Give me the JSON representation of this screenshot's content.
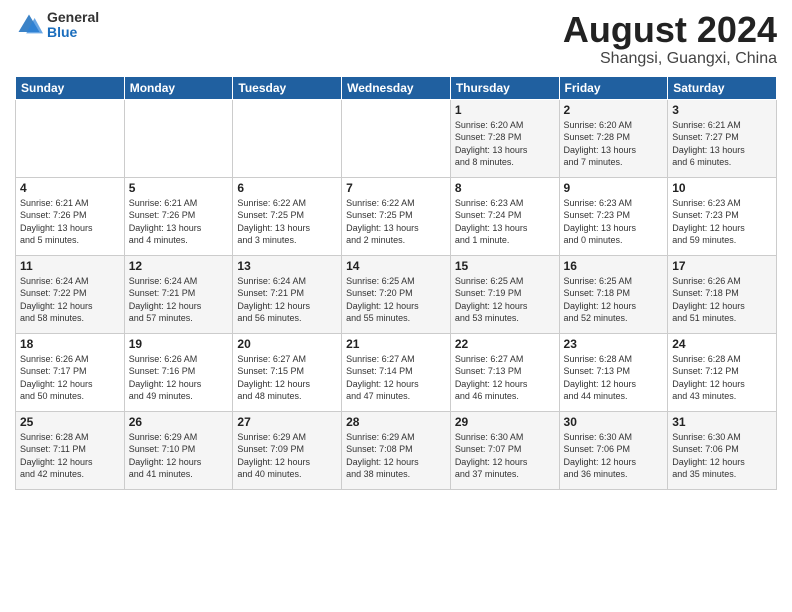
{
  "header": {
    "logo": {
      "general": "General",
      "blue": "Blue"
    },
    "title": "August 2024",
    "location": "Shangsi, Guangxi, China"
  },
  "weekdays": [
    "Sunday",
    "Monday",
    "Tuesday",
    "Wednesday",
    "Thursday",
    "Friday",
    "Saturday"
  ],
  "weeks": [
    [
      {
        "day": "",
        "info": ""
      },
      {
        "day": "",
        "info": ""
      },
      {
        "day": "",
        "info": ""
      },
      {
        "day": "",
        "info": ""
      },
      {
        "day": "1",
        "info": "Sunrise: 6:20 AM\nSunset: 7:28 PM\nDaylight: 13 hours\nand 8 minutes."
      },
      {
        "day": "2",
        "info": "Sunrise: 6:20 AM\nSunset: 7:28 PM\nDaylight: 13 hours\nand 7 minutes."
      },
      {
        "day": "3",
        "info": "Sunrise: 6:21 AM\nSunset: 7:27 PM\nDaylight: 13 hours\nand 6 minutes."
      }
    ],
    [
      {
        "day": "4",
        "info": "Sunrise: 6:21 AM\nSunset: 7:26 PM\nDaylight: 13 hours\nand 5 minutes."
      },
      {
        "day": "5",
        "info": "Sunrise: 6:21 AM\nSunset: 7:26 PM\nDaylight: 13 hours\nand 4 minutes."
      },
      {
        "day": "6",
        "info": "Sunrise: 6:22 AM\nSunset: 7:25 PM\nDaylight: 13 hours\nand 3 minutes."
      },
      {
        "day": "7",
        "info": "Sunrise: 6:22 AM\nSunset: 7:25 PM\nDaylight: 13 hours\nand 2 minutes."
      },
      {
        "day": "8",
        "info": "Sunrise: 6:23 AM\nSunset: 7:24 PM\nDaylight: 13 hours\nand 1 minute."
      },
      {
        "day": "9",
        "info": "Sunrise: 6:23 AM\nSunset: 7:23 PM\nDaylight: 13 hours\nand 0 minutes."
      },
      {
        "day": "10",
        "info": "Sunrise: 6:23 AM\nSunset: 7:23 PM\nDaylight: 12 hours\nand 59 minutes."
      }
    ],
    [
      {
        "day": "11",
        "info": "Sunrise: 6:24 AM\nSunset: 7:22 PM\nDaylight: 12 hours\nand 58 minutes."
      },
      {
        "day": "12",
        "info": "Sunrise: 6:24 AM\nSunset: 7:21 PM\nDaylight: 12 hours\nand 57 minutes."
      },
      {
        "day": "13",
        "info": "Sunrise: 6:24 AM\nSunset: 7:21 PM\nDaylight: 12 hours\nand 56 minutes."
      },
      {
        "day": "14",
        "info": "Sunrise: 6:25 AM\nSunset: 7:20 PM\nDaylight: 12 hours\nand 55 minutes."
      },
      {
        "day": "15",
        "info": "Sunrise: 6:25 AM\nSunset: 7:19 PM\nDaylight: 12 hours\nand 53 minutes."
      },
      {
        "day": "16",
        "info": "Sunrise: 6:25 AM\nSunset: 7:18 PM\nDaylight: 12 hours\nand 52 minutes."
      },
      {
        "day": "17",
        "info": "Sunrise: 6:26 AM\nSunset: 7:18 PM\nDaylight: 12 hours\nand 51 minutes."
      }
    ],
    [
      {
        "day": "18",
        "info": "Sunrise: 6:26 AM\nSunset: 7:17 PM\nDaylight: 12 hours\nand 50 minutes."
      },
      {
        "day": "19",
        "info": "Sunrise: 6:26 AM\nSunset: 7:16 PM\nDaylight: 12 hours\nand 49 minutes."
      },
      {
        "day": "20",
        "info": "Sunrise: 6:27 AM\nSunset: 7:15 PM\nDaylight: 12 hours\nand 48 minutes."
      },
      {
        "day": "21",
        "info": "Sunrise: 6:27 AM\nSunset: 7:14 PM\nDaylight: 12 hours\nand 47 minutes."
      },
      {
        "day": "22",
        "info": "Sunrise: 6:27 AM\nSunset: 7:13 PM\nDaylight: 12 hours\nand 46 minutes."
      },
      {
        "day": "23",
        "info": "Sunrise: 6:28 AM\nSunset: 7:13 PM\nDaylight: 12 hours\nand 44 minutes."
      },
      {
        "day": "24",
        "info": "Sunrise: 6:28 AM\nSunset: 7:12 PM\nDaylight: 12 hours\nand 43 minutes."
      }
    ],
    [
      {
        "day": "25",
        "info": "Sunrise: 6:28 AM\nSunset: 7:11 PM\nDaylight: 12 hours\nand 42 minutes."
      },
      {
        "day": "26",
        "info": "Sunrise: 6:29 AM\nSunset: 7:10 PM\nDaylight: 12 hours\nand 41 minutes."
      },
      {
        "day": "27",
        "info": "Sunrise: 6:29 AM\nSunset: 7:09 PM\nDaylight: 12 hours\nand 40 minutes."
      },
      {
        "day": "28",
        "info": "Sunrise: 6:29 AM\nSunset: 7:08 PM\nDaylight: 12 hours\nand 38 minutes."
      },
      {
        "day": "29",
        "info": "Sunrise: 6:30 AM\nSunset: 7:07 PM\nDaylight: 12 hours\nand 37 minutes."
      },
      {
        "day": "30",
        "info": "Sunrise: 6:30 AM\nSunset: 7:06 PM\nDaylight: 12 hours\nand 36 minutes."
      },
      {
        "day": "31",
        "info": "Sunrise: 6:30 AM\nSunset: 7:06 PM\nDaylight: 12 hours\nand 35 minutes."
      }
    ]
  ]
}
